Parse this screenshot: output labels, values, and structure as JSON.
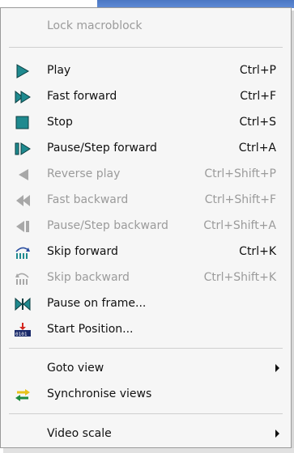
{
  "menu": {
    "items": [
      {
        "id": "lock",
        "label": "Lock macroblock",
        "shortcut": "",
        "disabled": true,
        "icon": null
      },
      {
        "id": "play",
        "label": "Play",
        "shortcut": "Ctrl+P",
        "disabled": false,
        "icon": "play-icon"
      },
      {
        "id": "fast-forward",
        "label": "Fast forward",
        "shortcut": "Ctrl+F",
        "disabled": false,
        "icon": "fast-forward-icon"
      },
      {
        "id": "stop",
        "label": "Stop",
        "shortcut": "Ctrl+S",
        "disabled": false,
        "icon": "stop-icon"
      },
      {
        "id": "pause-step-forward",
        "label": "Pause/Step forward",
        "shortcut": "Ctrl+A",
        "disabled": false,
        "icon": "pause-step-forward-icon"
      },
      {
        "id": "reverse-play",
        "label": "Reverse play",
        "shortcut": "Ctrl+Shift+P",
        "disabled": true,
        "icon": "reverse-play-icon"
      },
      {
        "id": "fast-backward",
        "label": "Fast backward",
        "shortcut": "Ctrl+Shift+F",
        "disabled": true,
        "icon": "fast-backward-icon"
      },
      {
        "id": "pause-step-backward",
        "label": "Pause/Step backward",
        "shortcut": "Ctrl+Shift+A",
        "disabled": true,
        "icon": "pause-step-backward-icon"
      },
      {
        "id": "skip-forward",
        "label": "Skip forward",
        "shortcut": "Ctrl+K",
        "disabled": false,
        "icon": "skip-forward-icon"
      },
      {
        "id": "skip-backward",
        "label": "Skip backward",
        "shortcut": "Ctrl+Shift+K",
        "disabled": true,
        "icon": "skip-backward-icon"
      },
      {
        "id": "pause-on-frame",
        "label": "Pause on frame...",
        "shortcut": "",
        "disabled": false,
        "icon": "pause-on-frame-icon"
      },
      {
        "id": "start-position",
        "label": "Start Position...",
        "shortcut": "",
        "disabled": false,
        "icon": "start-position-icon"
      },
      {
        "id": "goto-view",
        "label": "Goto view",
        "shortcut": "",
        "disabled": false,
        "icon": null,
        "submenu": true
      },
      {
        "id": "synchronise-views",
        "label": "Synchronise views",
        "shortcut": "",
        "disabled": false,
        "icon": "synchronise-views-icon"
      },
      {
        "id": "video-scale",
        "label": "Video scale",
        "shortcut": "",
        "disabled": false,
        "icon": null,
        "submenu": true
      }
    ]
  },
  "colors": {
    "menu_bg": "#f6f6f6",
    "icon_teal": "#1f8a8f",
    "icon_disabled": "#9b9b9b",
    "disabled_text": "#9b9b9b",
    "title_bar": "#5f8bd6"
  }
}
